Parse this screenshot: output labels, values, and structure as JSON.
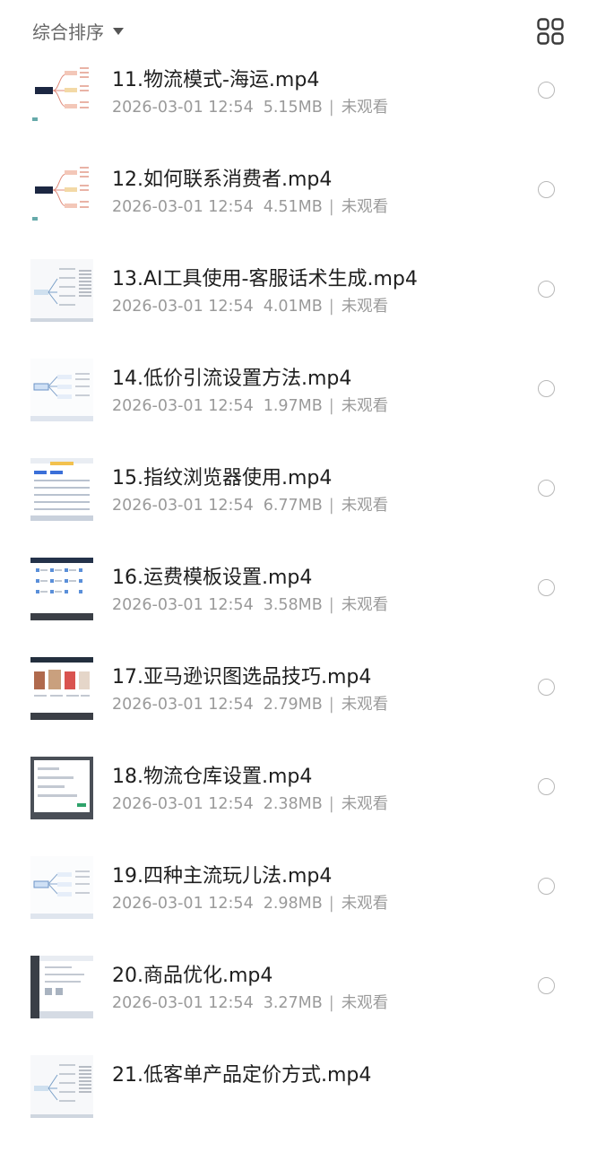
{
  "header": {
    "sort_label": "综合排序",
    "sort_icon": "caret-down-icon",
    "view_toggle_icon": "grid-view-icon"
  },
  "items": [
    {
      "title": "11.物流模式-海运.mp4",
      "date": "2026-03-01 12:54",
      "size": "5.15MB",
      "status": "未观看",
      "thumb": "mindmap-dark"
    },
    {
      "title": "12.如何联系消费者.mp4",
      "date": "2026-03-01 12:54",
      "size": "4.51MB",
      "status": "未观看",
      "thumb": "mindmap-dark"
    },
    {
      "title": "13.AI工具使用-客服话术生成.mp4",
      "date": "2026-03-01 12:54",
      "size": "4.01MB",
      "status": "未观看",
      "thumb": "mindmap-text"
    },
    {
      "title": "14.低价引流设置方法.mp4",
      "date": "2026-03-01 12:54",
      "size": "1.97MB",
      "status": "未观看",
      "thumb": "mindmap-blue"
    },
    {
      "title": "15.指纹浏览器使用.mp4",
      "date": "2026-03-01 12:54",
      "size": "6.77MB",
      "status": "未观看",
      "thumb": "screen-table"
    },
    {
      "title": "16.运费模板设置.mp4",
      "date": "2026-03-01 12:54",
      "size": "3.58MB",
      "status": "未观看",
      "thumb": "screen-grid"
    },
    {
      "title": "17.亚马逊识图选品技巧.mp4",
      "date": "2026-03-01 12:54",
      "size": "2.79MB",
      "status": "未观看",
      "thumb": "screen-products"
    },
    {
      "title": "18.物流仓库设置.mp4",
      "date": "2026-03-01 12:54",
      "size": "2.38MB",
      "status": "未观看",
      "thumb": "screen-form"
    },
    {
      "title": "19.四种主流玩儿法.mp4",
      "date": "2026-03-01 12:54",
      "size": "2.98MB",
      "status": "未观看",
      "thumb": "mindmap-blue"
    },
    {
      "title": "20.商品优化.mp4",
      "date": "2026-03-01 12:54",
      "size": "3.27MB",
      "status": "未观看",
      "thumb": "screen-side"
    },
    {
      "title": "21.低客单产品定价方式.mp4",
      "date": "",
      "size": "",
      "status": "",
      "thumb": "mindmap-text"
    }
  ]
}
